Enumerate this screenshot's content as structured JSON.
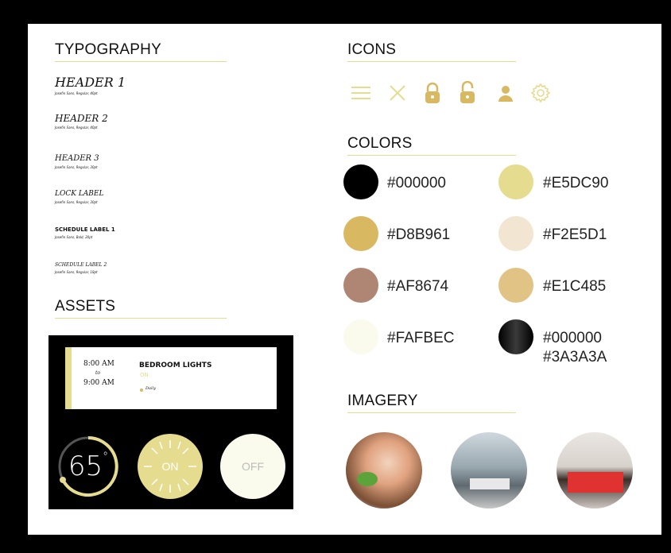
{
  "typography": {
    "title": "TYPOGRAPHY",
    "items": [
      {
        "label": "HEADER 1",
        "meta": "Josefin Sans, Regular, 40pt"
      },
      {
        "label": "HEADER 2",
        "meta": "Josefin Sans, Regular, 40pt"
      },
      {
        "label": "HEADER 3",
        "meta": "Josefin Sans, Regular, 30pt"
      },
      {
        "label": "LOCK LABEL",
        "meta": "Josefin Sans, Regular, 30pt"
      },
      {
        "label": "SCHEDULE LABEL 1",
        "meta": "Josefin Sans, Bold, 20pt"
      },
      {
        "label": "SCHEDULE LABEL 2",
        "meta": "Josefin Sans, Regular, 18pt"
      }
    ]
  },
  "icons": {
    "title": "ICONS",
    "items": [
      "menu-icon",
      "close-icon",
      "lock-closed-icon",
      "lock-open-icon",
      "user-icon",
      "gear-icon"
    ],
    "color": "#D8B961"
  },
  "colors": {
    "title": "COLORS",
    "swatches": [
      {
        "hex": "#000000"
      },
      {
        "hex": "#E5DC90"
      },
      {
        "hex": "#D8B961"
      },
      {
        "hex": "#F2E5D1"
      },
      {
        "hex": "#AF8674"
      },
      {
        "hex": "#E1C485"
      },
      {
        "hex": "#FAFBEC"
      },
      {
        "hex": "#000000",
        "hex2": "#3A3A3A"
      }
    ]
  },
  "assets": {
    "title": "ASSETS",
    "schedule": {
      "start": "8:00 AM",
      "to": "to",
      "end": "9:00 AM",
      "name": "BEDROOM LIGHTS",
      "state": "ON",
      "repeat": "Daily"
    },
    "thermostat": {
      "value": "65",
      "unit": "°"
    },
    "on_label": "ON",
    "off_label": "OFF"
  },
  "imagery": {
    "title": "IMAGERY",
    "photos": [
      "woman-eating-photo",
      "living-room-photo",
      "bedroom-photo"
    ]
  }
}
